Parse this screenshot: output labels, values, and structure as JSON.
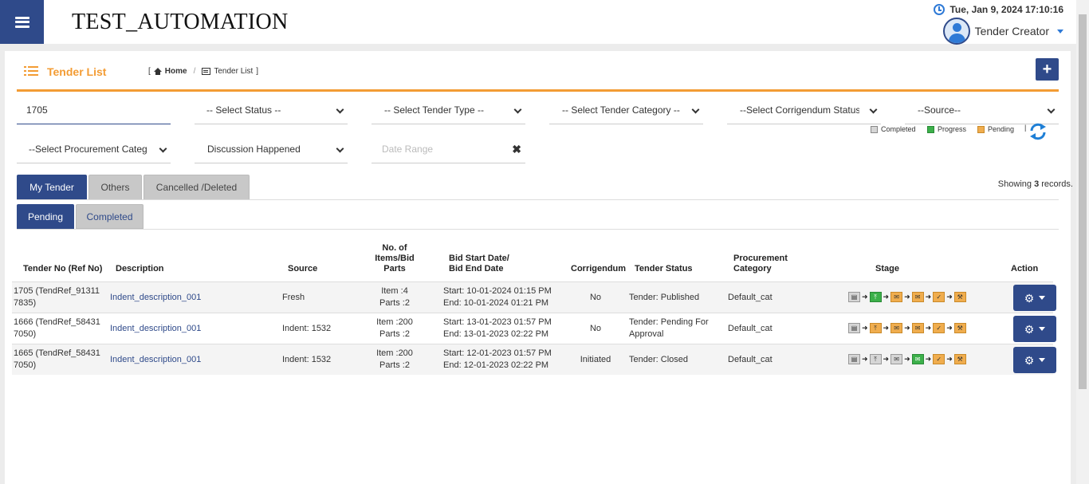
{
  "header": {
    "app_title": "TEST_AUTOMATION",
    "datetime": "Tue, Jan 9, 2024 17:10:16",
    "user_role": "Tender Creator"
  },
  "page": {
    "title": "Tender List",
    "breadcrumb": [
      "Home",
      "Tender List"
    ],
    "add_label": "+"
  },
  "filters": {
    "search_value": "1705",
    "status": "-- Select Status --",
    "tender_type": "-- Select Tender Type --",
    "tender_category": "-- Select Tender Category --",
    "corrigendum": "--Select Corrigendum Status--",
    "source": "--Source--",
    "procurement_category": "--Select Procurement Category--",
    "discussion": "Discussion Happened",
    "date_range_placeholder": "Date Range",
    "clear_label": "✖"
  },
  "tabs": {
    "main": [
      "My Tender",
      "Others",
      "Cancelled /Deleted"
    ],
    "sub": [
      "Pending",
      "Completed"
    ]
  },
  "legend": [
    {
      "label": "Completed",
      "color": "#d6d6d6"
    },
    {
      "label": "Progress",
      "color": "#3cb04a"
    },
    {
      "label": "Pending",
      "color": "#f0ad4e"
    }
  ],
  "showing": {
    "prefix": "Showing",
    "count": "3",
    "suffix": "records."
  },
  "table": {
    "headers": {
      "tender_no": "Tender No (Ref No)",
      "description": "Description",
      "source": "Source",
      "items": [
        "No. of",
        "Items/Bid",
        "Parts"
      ],
      "dates": [
        "Bid Start Date/",
        "Bid End Date"
      ],
      "corrigendum": "Corrigendum",
      "status": "Tender Status",
      "category": [
        "Procurement",
        "Category"
      ],
      "stage": "Stage",
      "action": "Action"
    },
    "rows": [
      {
        "tender_no": [
          "1705 (TendRef_91311",
          "7835)"
        ],
        "description": "Indent_description_001",
        "source": "Fresh",
        "items": [
          "Item :4",
          "Parts :2"
        ],
        "dates": [
          "Start: 10-01-2024 01:15 PM",
          "End: 10-01-2024 01:21 PM"
        ],
        "corrigendum": "No",
        "status": [
          "Tender: Published"
        ],
        "category": "Default_cat",
        "stages": [
          "gray",
          "green",
          "orange",
          "orange",
          "orange",
          "orange"
        ]
      },
      {
        "tender_no": [
          "1666 (TendRef_58431",
          "7050)"
        ],
        "description": "Indent_description_001",
        "source": "Indent: 1532",
        "items": [
          "Item :200",
          "Parts :2"
        ],
        "dates": [
          "Start: 13-01-2023 01:57 PM",
          "End: 13-01-2023 02:22 PM"
        ],
        "corrigendum": "No",
        "status": [
          "Tender: Pending For",
          "Approval"
        ],
        "category": "Default_cat",
        "stages": [
          "gray",
          "orange",
          "orange",
          "orange",
          "orange",
          "orange"
        ]
      },
      {
        "tender_no": [
          "1665 (TendRef_58431",
          "7050)"
        ],
        "description": "Indent_description_001",
        "source": "Indent: 1532",
        "items": [
          "Item :200",
          "Parts :2"
        ],
        "dates": [
          "Start: 12-01-2023 01:57 PM",
          "End: 12-01-2023 02:22 PM"
        ],
        "corrigendum": "Initiated",
        "status": [
          "Tender: Closed"
        ],
        "category": "Default_cat",
        "stages": [
          "gray",
          "gray",
          "gray",
          "green",
          "orange",
          "orange"
        ]
      }
    ],
    "stage_icons": [
      "document-icon",
      "upload-icon",
      "envelope-open-icon",
      "envelope-icon",
      "check-icon",
      "gavel-icon"
    ]
  },
  "colors": {
    "primary": "#2f4a8a",
    "accent": "#f39c34"
  }
}
